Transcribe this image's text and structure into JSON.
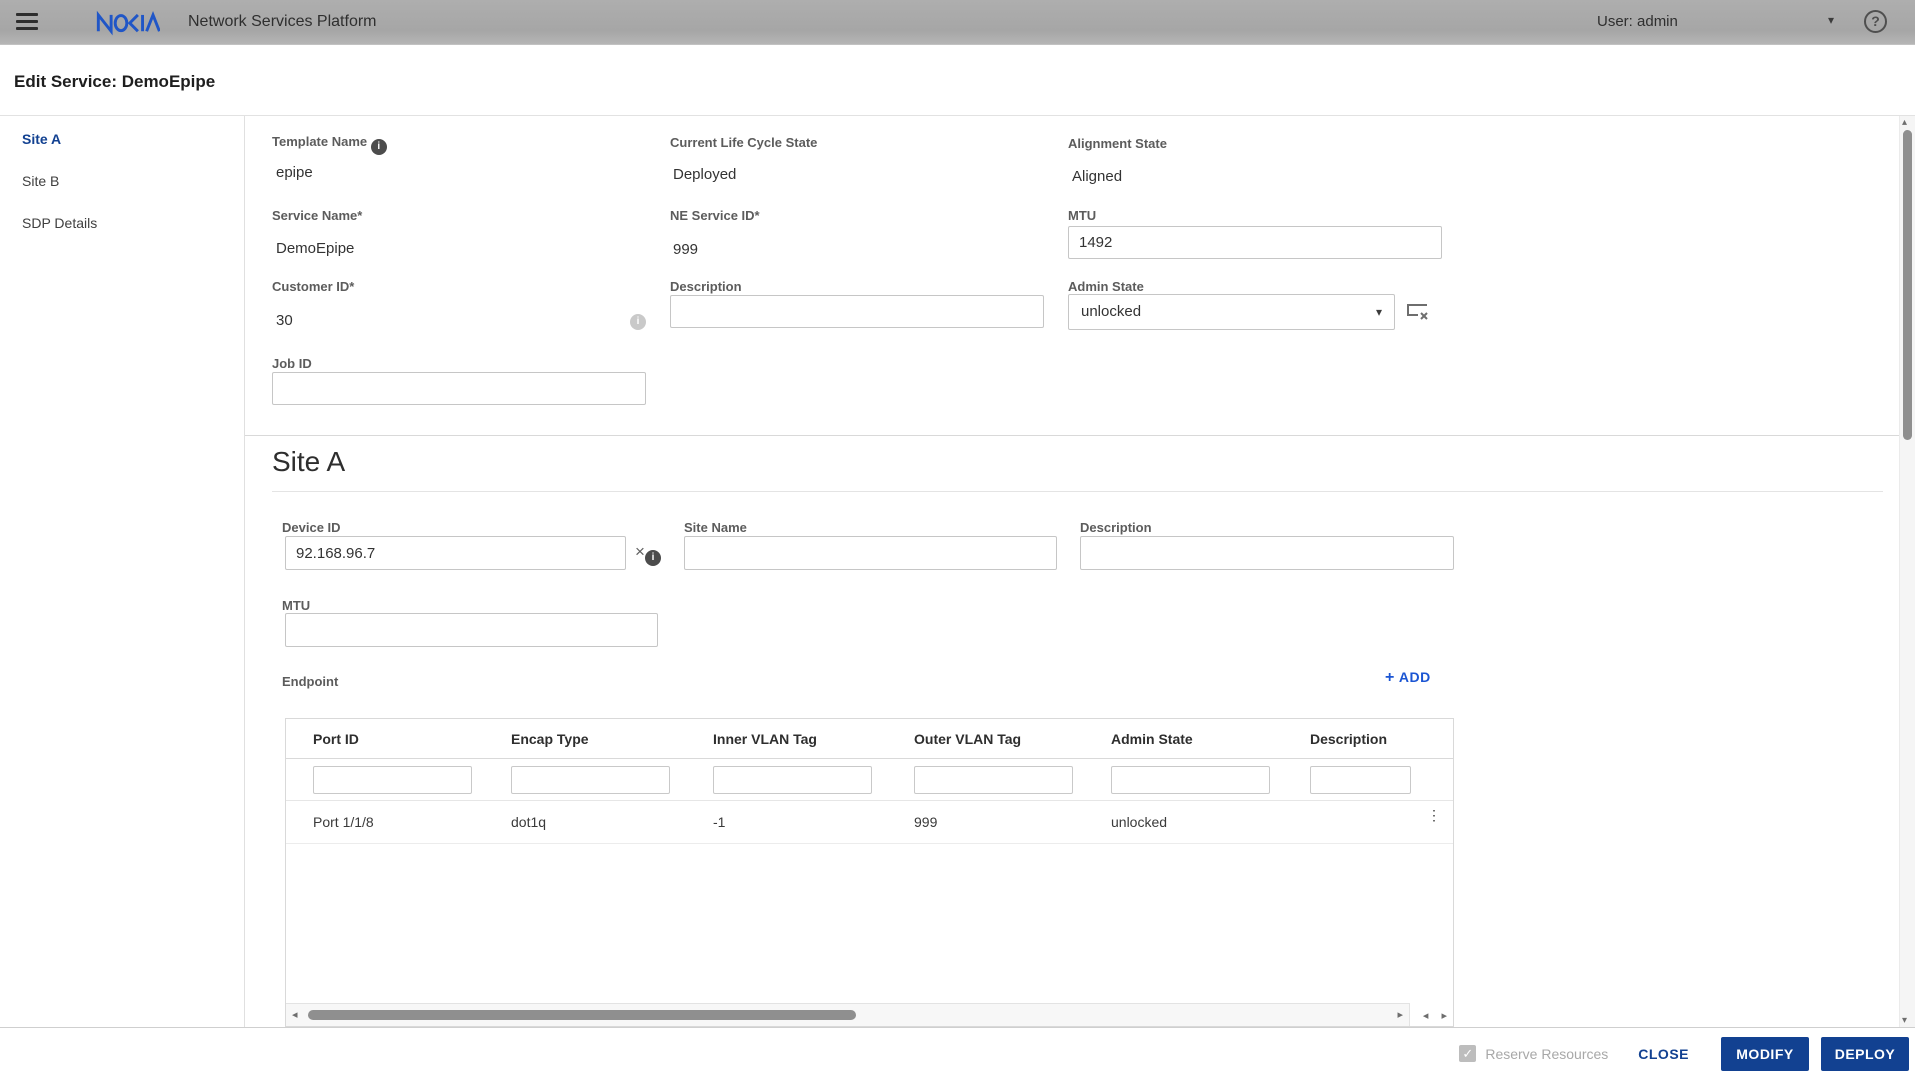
{
  "topbar": {
    "app_title": "Network Services Platform",
    "user": "User: admin"
  },
  "page": {
    "title": "Edit Service: DemoEpipe"
  },
  "sidebar": {
    "items": [
      {
        "label": "Site A"
      },
      {
        "label": "Site B"
      },
      {
        "label": "SDP Details"
      }
    ]
  },
  "service_form": {
    "template_name": {
      "label": "Template Name",
      "value": "epipe"
    },
    "lifecycle": {
      "label": "Current Life Cycle State",
      "value": "Deployed"
    },
    "alignment": {
      "label": "Alignment State",
      "value": "Aligned"
    },
    "service_name": {
      "label": "Service Name*",
      "value": "DemoEpipe"
    },
    "ne_service_id": {
      "label": "NE Service ID*",
      "value": "999"
    },
    "mtu": {
      "label": "MTU",
      "value": "1492"
    },
    "customer_id": {
      "label": "Customer ID*",
      "value": "30"
    },
    "description": {
      "label": "Description",
      "value": ""
    },
    "admin_state": {
      "label": "Admin State",
      "value": "unlocked"
    },
    "job_id": {
      "label": "Job ID",
      "value": ""
    }
  },
  "site_section": {
    "title": "Site A",
    "device_id": {
      "label": "Device ID",
      "value": "92.168.96.7"
    },
    "site_name": {
      "label": "Site Name",
      "value": ""
    },
    "description": {
      "label": "Description",
      "value": ""
    },
    "mtu": {
      "label": "MTU",
      "value": ""
    },
    "endpoint": {
      "label": "Endpoint",
      "add_label": "ADD",
      "columns": [
        "Port ID",
        "Encap Type",
        "Inner VLAN Tag",
        "Outer VLAN Tag",
        "Admin State",
        "Description"
      ],
      "rows": [
        [
          "Port 1/1/8",
          "dot1q",
          "-1",
          "999",
          "unlocked",
          ""
        ]
      ]
    }
  },
  "footer": {
    "reserve_label": "Reserve Resources",
    "close_label": "CLOSE",
    "modify_label": "MODIFY",
    "deploy_label": "DEPLOY"
  },
  "icons": {
    "info": "i",
    "help": "?",
    "caret_down": "▾",
    "clear": "×",
    "kebab": "⋮",
    "plus": "+",
    "check": "✓",
    "arrow_left": "◂",
    "arrow_right": "▸",
    "arrow_up": "▴",
    "arrow_down": "▾"
  },
  "colors": {
    "accent_blue": "#124191",
    "link_blue": "#1b55d3",
    "topbar_gray": "#a6a6a6"
  }
}
